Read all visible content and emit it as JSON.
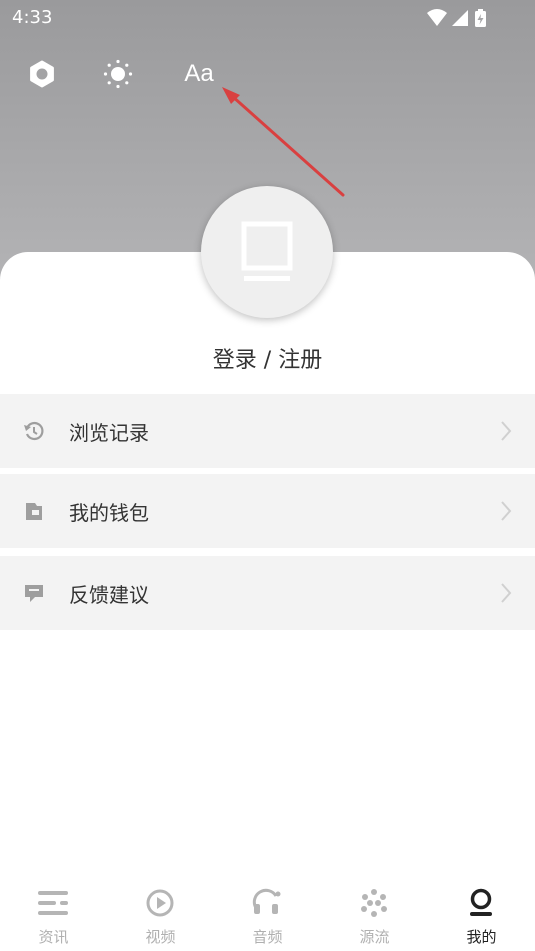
{
  "status_bar": {
    "time": "4:33"
  },
  "header": {
    "font_button_label": "Aa",
    "icons": [
      "settings-gear-icon",
      "brightness-icon",
      "font-size-icon"
    ]
  },
  "profile": {
    "login_label": "登录 / 注册"
  },
  "menu": {
    "items": [
      {
        "label": "浏览记录",
        "icon": "history-icon"
      },
      {
        "label": "我的钱包",
        "icon": "wallet-icon"
      },
      {
        "label": "反馈建议",
        "icon": "feedback-icon"
      }
    ]
  },
  "tabbar": {
    "tabs": [
      {
        "label": "资讯",
        "icon": "news-icon",
        "active": false
      },
      {
        "label": "视频",
        "icon": "video-play-icon",
        "active": false
      },
      {
        "label": "音频",
        "icon": "headphones-icon",
        "active": false
      },
      {
        "label": "源流",
        "icon": "source-dots-icon",
        "active": false
      },
      {
        "label": "我的",
        "icon": "profile-icon",
        "active": true
      }
    ]
  },
  "colors": {
    "header_gray": "#a6a6a8",
    "panel": "#ffffff",
    "menu_bg": "#f3f3f3",
    "arrow_red": "#d94040",
    "tab_inactive": "#b0b0b0",
    "tab_active": "#222222"
  }
}
